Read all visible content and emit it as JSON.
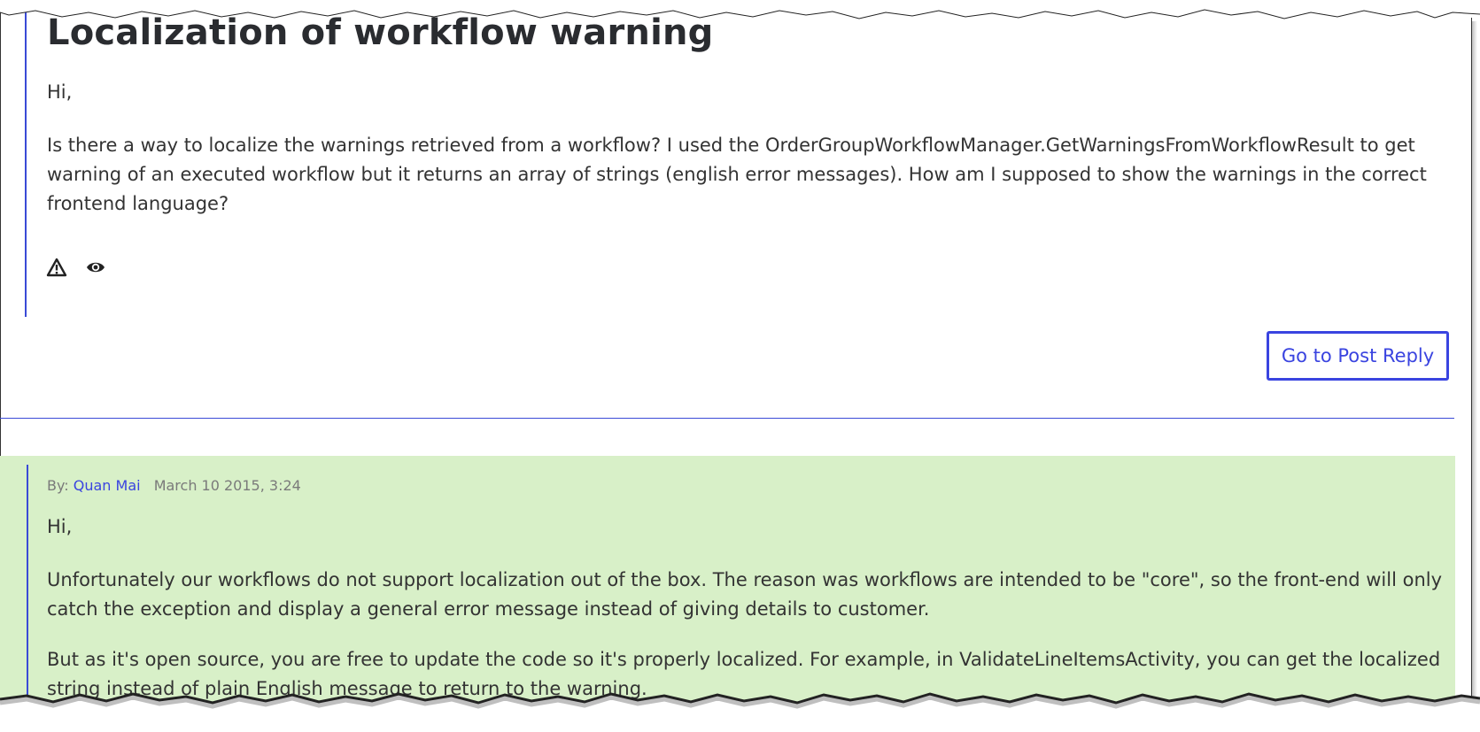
{
  "question": {
    "title": "Localization of workflow warning",
    "greeting": "Hi,",
    "body": "Is there a way to localize the warnings retrieved from a workflow? I used the OrderGroupWorkflowManager.GetWarningsFromWorkflowResult to get warning of an executed workflow but it returns an array of strings (english error messages). How am I supposed to show the warnings in the correct frontend language?",
    "icons": [
      "warning-icon",
      "eye-icon"
    ]
  },
  "reply_button": {
    "label": "Go to Post Reply"
  },
  "answer": {
    "by_label": "By:",
    "author": "Quan Mai",
    "date": "March 10 2015, 3:24",
    "greeting": "Hi,",
    "paragraph1": "Unfortunately our workflows do not support localization out of the box. The reason was workflows are intended to be \"core\", so the front-end will only catch the exception and display a general error message instead of giving details to customer.",
    "paragraph2": "But as it's open source, you are free to update the code so it's properly localized. For example, in ValidateLineItemsActivity, you can get the localized string instead of plain English message to return to the warning."
  },
  "colors": {
    "accent": "#3a44e0",
    "answer_background": "#d8f0c8",
    "text": "#333333"
  }
}
